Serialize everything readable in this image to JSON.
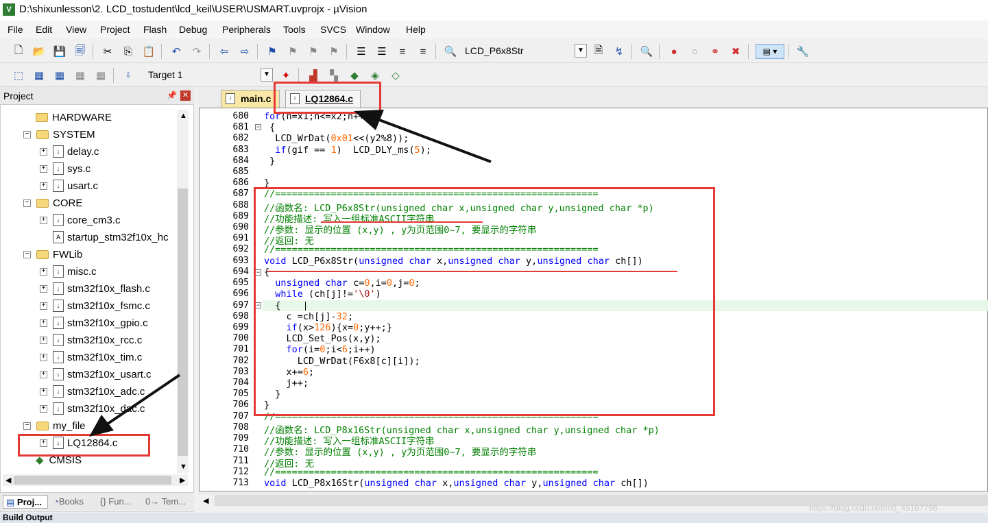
{
  "window": {
    "title": "D:\\shixunlesson\\2. LCD_tostudent\\lcd_keil\\USER\\USMART.uvprojx - µVision",
    "icon_letter": "V"
  },
  "menu": [
    "File",
    "Edit",
    "View",
    "Project",
    "Flash",
    "Debug",
    "Peripherals",
    "Tools",
    "SVCS",
    "Window",
    "Help"
  ],
  "toolbar1": {
    "find_combo_value": "LCD_P6x8Str"
  },
  "toolbar2": {
    "target_combo_value": "Target 1"
  },
  "project_panel": {
    "title": "Project",
    "tree": [
      "HARDWARE",
      "SYSTEM",
      "delay.c",
      "sys.c",
      "usart.c",
      "CORE",
      "core_cm3.c",
      "startup_stm32f10x_hc",
      "FWLib",
      "misc.c",
      "stm32f10x_flash.c",
      "stm32f10x_fsmc.c",
      "stm32f10x_gpio.c",
      "stm32f10x_rcc.c",
      "stm32f10x_tim.c",
      "stm32f10x_usart.c",
      "stm32f10x_adc.c",
      "stm32f10x_dac.c",
      "my_file",
      "LQ12864.c",
      "CMSIS"
    ],
    "bottom_tabs": [
      "Proj...",
      "Books",
      "{} Fun...",
      "0→ Tem..."
    ]
  },
  "editor": {
    "tabs": [
      "main.c",
      "LQ12864.c"
    ],
    "line_numbers": [
      "680",
      "681",
      "682",
      "683",
      "684",
      "685",
      "686",
      "687",
      "688",
      "689",
      "690",
      "691",
      "692",
      "693",
      "694",
      "695",
      "696",
      "697",
      "698",
      "699",
      "700",
      "701",
      "702",
      "703",
      "704",
      "705",
      "706",
      "707",
      "708",
      "709",
      "710",
      "711",
      "712",
      "713"
    ],
    "code": {
      "l680": "  for(n=x1;n<=x2;n++)",
      "l681": " {",
      "l682a": "  LCD_WrDat(",
      "l682b": "0x01",
      "l682c": "<<(y2%8));",
      "l683a": "  ",
      "l683b": "if",
      "l683c": "(gif == ",
      "l683d": "1",
      "l683e": ")  LCD_DLY_ms(",
      "l683f": "5",
      "l683g": ");",
      "l684": " }",
      "l685": "",
      "l686": "}",
      "l687": "//==========================================================",
      "l688": "//函数名: LCD_P6x8Str(unsigned char x,unsigned char y,unsigned char *p)",
      "l689": "//功能描述: 写入一组标准ASCII字符串",
      "l690": "//参数: 显示的位置 (x,y) , y为页范围0~7, 要显示的字符串",
      "l691": "//返回: 无",
      "l692": "//==========================================================",
      "l693a": "void",
      "l693b": " LCD_P6x8Str(",
      "l693c": "unsigned char",
      "l693d": " x,",
      "l693e": "unsigned char",
      "l693f": " y,",
      "l693g": "unsigned char",
      "l693h": " ch[])",
      "l694": "{",
      "l695a": "  ",
      "l695b": "unsigned char",
      "l695c": " c=",
      "l695d": "0",
      "l695e": ",i=",
      "l695f": "0",
      "l695g": ",j=",
      "l695h": "0",
      "l695i": ";",
      "l696a": "  ",
      "l696b": "while",
      "l696c": " (ch[j]!=",
      "l696d": "'\\0'",
      "l696e": ")",
      "l697": "  {",
      "l698a": "    c =ch[j]-",
      "l698b": "32",
      "l698c": ";",
      "l699a": "    ",
      "l699b": "if",
      "l699c": "(x>",
      "l699d": "126",
      "l699e": "){x=",
      "l699f": "0",
      "l699g": ";y++;}",
      "l700": "    LCD_Set_Pos(x,y);",
      "l701a": "    ",
      "l701b": "for",
      "l701c": "(i=",
      "l701d": "0",
      "l701e": ";i<",
      "l701f": "6",
      "l701g": ";i++)",
      "l702": "      LCD_WrDat(F6x8[c][i]);",
      "l703a": "    x+=",
      "l703b": "6",
      "l703c": ";",
      "l704": "    j++;",
      "l705": "  }",
      "l706": "}",
      "l707": "//==========================================================",
      "l708": "//函数名: LCD_P8x16Str(unsigned char x,unsigned char y,unsigned char *p)",
      "l709": "//功能描述: 写入一组标准ASCII字符串",
      "l710": "//参数: 显示的位置 (x,y) , y为页范围0~7, 要显示的字符串",
      "l711": "//返回: 无",
      "l712": "//==========================================================",
      "l713a": "void",
      "l713b": " LCD_P8x16Str(",
      "l713c": "unsigned char",
      "l713d": " x,",
      "l713e": "unsigned char",
      "l713f": " y,",
      "l713g": "unsigned char",
      "l713h": " ch[])"
    }
  },
  "status_bar": "Build Output",
  "watermark": "https://blog.csdn.net/m0_45167796"
}
